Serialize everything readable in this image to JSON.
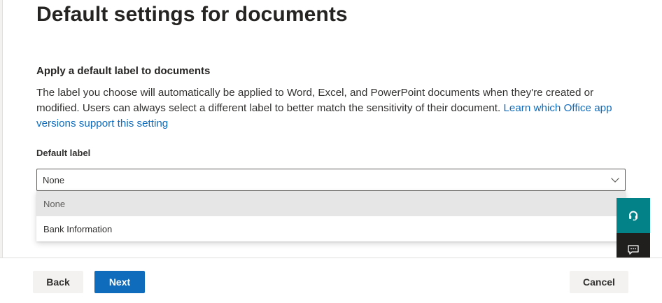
{
  "page": {
    "title": "Default settings for documents"
  },
  "section": {
    "heading": "Apply a default label to documents",
    "description": "The label you choose will automatically be applied to Word, Excel, and PowerPoint documents when they're created or modified. Users can always select a different label to better match the sensitivity of their document.",
    "learn_more_link": "Learn which Office app versions support this setting"
  },
  "default_label": {
    "label": "Default label",
    "selected_value": "None",
    "options": [
      {
        "label": "None",
        "selected": true
      },
      {
        "label": "Bank Information",
        "selected": false
      }
    ]
  },
  "floating": {
    "support_icon": "headset-icon",
    "feedback_icon": "chat-feedback-icon"
  },
  "footer": {
    "back_label": "Back",
    "next_label": "Next",
    "cancel_label": "Cancel"
  },
  "colors": {
    "accent": "#0f6cbd",
    "support_fab": "#038387",
    "feedback_fab": "#201f1e",
    "selected_option_bg": "#e6e6e6"
  }
}
